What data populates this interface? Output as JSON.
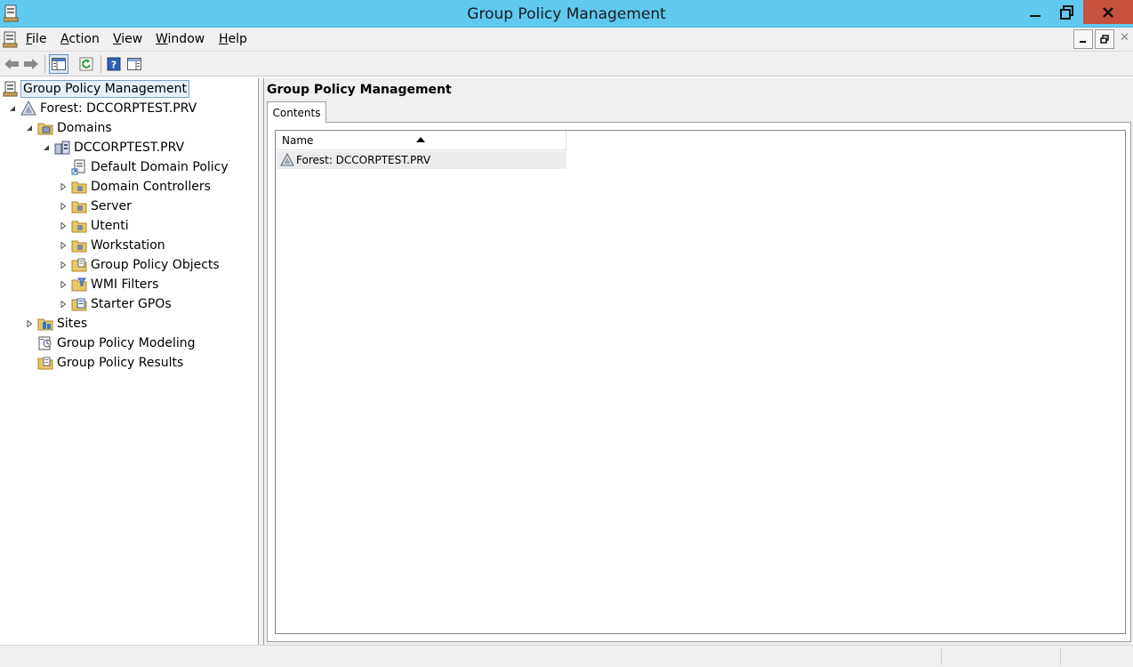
{
  "window": {
    "title": "Group Policy Management",
    "controls": [
      "minimize-icon",
      "restore-icon",
      "close-icon"
    ]
  },
  "menu": {
    "items": [
      "File",
      "Action",
      "View",
      "Window",
      "Help"
    ]
  },
  "toolbar": {
    "buttons": [
      "back-arrow-icon",
      "forward-arrow-icon",
      "show-hide-tree-icon",
      "refresh-icon",
      "help-icon",
      "show-hide-action-pane-icon"
    ]
  },
  "tree": {
    "root": "Group Policy Management",
    "forest": "Forest: DCCORPTEST.PRV",
    "domains": "Domains",
    "domain": "DCCORPTEST.PRV",
    "domain_children": [
      "Default Domain Policy",
      "Domain Controllers",
      "Server",
      "Utenti",
      "Workstation",
      "Group Policy Objects",
      "WMI Filters",
      "Starter GPOs"
    ],
    "sites": "Sites",
    "modeling": "Group Policy Modeling",
    "results": "Group Policy Results"
  },
  "content": {
    "heading": "Group Policy Management",
    "tab": "Contents",
    "column": "Name",
    "rows": [
      "Forest: DCCORPTEST.PRV"
    ]
  },
  "colors": {
    "titlebar": "#60c9f0",
    "close_button": "#c7503f",
    "selection": "#e5f0fb"
  }
}
